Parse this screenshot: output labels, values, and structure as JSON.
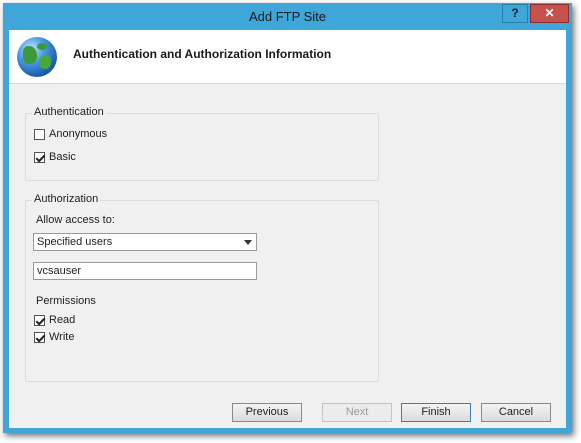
{
  "window": {
    "title": "Add FTP Site",
    "help_label": "?",
    "close_label": "✕"
  },
  "header": {
    "title": "Authentication and Authorization Information"
  },
  "authentication": {
    "legend": "Authentication",
    "anonymous": {
      "label": "Anonymous",
      "checked": false
    },
    "basic": {
      "label": "Basic",
      "checked": true
    }
  },
  "authorization": {
    "legend": "Authorization",
    "allow_access_label": "Allow access to:",
    "allow_access_value": "Specified users",
    "users_value": "vcsauser",
    "permissions_label": "Permissions",
    "read": {
      "label": "Read",
      "checked": true
    },
    "write": {
      "label": "Write",
      "checked": true
    }
  },
  "buttons": {
    "previous": "Previous",
    "next": "Next",
    "finish": "Finish",
    "cancel": "Cancel"
  }
}
